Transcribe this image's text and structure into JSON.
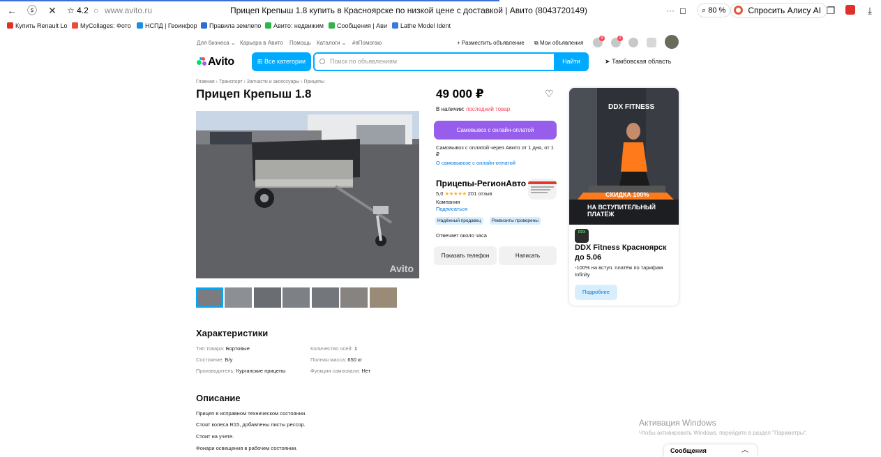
{
  "browser": {
    "rating": "4.2",
    "url": "www.avito.ru",
    "page_title": "Прицеп Крепыш 1.8 купить в Красноярске по низкой цене с доставкой | Авито (8043720149)",
    "zoom": "80 %",
    "alice_label": "Спросить Алису AI",
    "bookmarks": [
      {
        "label": "Купить Renault Lo",
        "color": "#e0302a"
      },
      {
        "label": "MyCollages: Фото",
        "color": "#e84c3d"
      },
      {
        "label": "НСПД | Геоинфор",
        "color": "#1c8ee0"
      },
      {
        "label": "Правила землепо",
        "color": "#2a6fd0"
      },
      {
        "label": "Авито: недвижим",
        "color": "#32b24a"
      },
      {
        "label": "Сообщения | Ави",
        "color": "#32b24a"
      },
      {
        "label": "Lathe Model Ident",
        "color": "#3a7bd5"
      }
    ]
  },
  "avito": {
    "top_links": [
      "Для бизнеса ⌄",
      "Карьера в Авито",
      "Помощь",
      "Каталоги ⌄",
      "#яПомогаю"
    ],
    "post_ad": "+ Разместить объявление",
    "my_ads": "Мои объявления",
    "badges": [
      "9",
      "2"
    ],
    "logo": "Avito",
    "all_categories": "Все категории",
    "search_placeholder": "Поиск по объявлениям",
    "find": "Найти",
    "region": "Тамбовская область",
    "breadcrumb": "Главная › Транспорт › Запчасти и аксессуары › Прицепы",
    "title": "Прицеп Крепыш 1.8",
    "watermark": "Avito",
    "price": "49 000 ₽",
    "stock_label": "В наличии:",
    "stock_value": "последний товар",
    "pickup_button": "Самовывоз с онлайн-оплатой",
    "pickup_text": "Самовывоз с оплатой через Авито от 1 дня, от 1 ₽",
    "pickup_link": "О самовывозе с онлайн-оплатой",
    "seller_name": "Прицепы-РегионАвто",
    "seller_rating": "5,0",
    "seller_stars": "★★★★★",
    "seller_reviews": "201 отзыв",
    "seller_type": "Компания",
    "subscribe": "Подписаться",
    "tags": [
      "Надёжный продавец",
      "Реквизиты проверены"
    ],
    "responds": "Отвечает около часа",
    "show_phone": "Показать телефон",
    "write": "Написать"
  },
  "ad": {
    "brand": "DDX FITNESS",
    "banner_line1": "СКИДКА 100%",
    "banner_line2": "НА ВСТУПИТЕЛЬНЫЙ ПЛАТЁЖ",
    "logo_text": "DDX",
    "title": "DDX Fitness Красноярск до 5.06",
    "text": "-100% на вступ. платёж по тарифам Infinity",
    "button": "Подробнее"
  },
  "specs": {
    "heading": "Характеристики",
    "items": [
      {
        "k": "Тип товара:",
        "v": "Бортовые"
      },
      {
        "k": "Состояние:",
        "v": "Б/у"
      },
      {
        "k": "Производитель:",
        "v": "Курганские прицепы"
      },
      {
        "k": "Количество осей:",
        "v": "1"
      },
      {
        "k": "Полная масса:",
        "v": "650 кг"
      },
      {
        "k": "Функция самосвала:",
        "v": "Нет"
      }
    ]
  },
  "description": {
    "heading": "Описание",
    "lines": [
      "Прицеп в исправном техническом состоянии.",
      "Стоят колеса R15, добавлены листы рессор.",
      "Стоит на учете.",
      "Фонари освещения в рабочем состоянии."
    ]
  },
  "windows": {
    "activation_title": "Активация Windows",
    "activation_text": "Чтобы активировать Windows, перейдите в раздел \"Параметры\"."
  },
  "messages_bar": "Сообщения"
}
